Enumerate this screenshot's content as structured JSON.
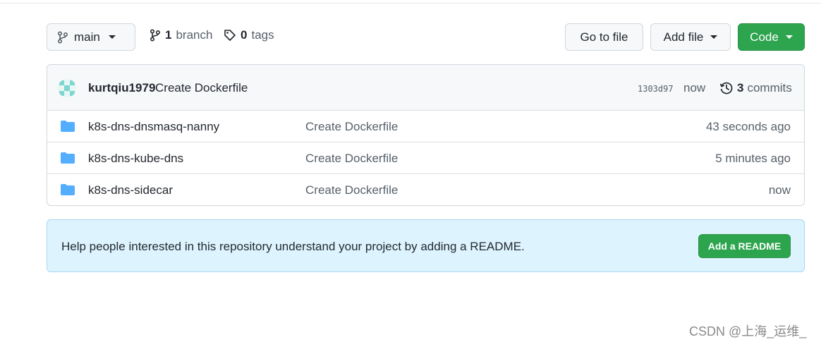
{
  "toolbar": {
    "branch_name": "main",
    "branch_count": "1",
    "branch_label": "branch",
    "tag_count": "0",
    "tag_label": "tags",
    "go_to_file": "Go to file",
    "add_file": "Add file",
    "code": "Code"
  },
  "latest_commit": {
    "author": "kurtqiu1979",
    "message": "Create Dockerfile",
    "sha": "1303d97",
    "time": "now",
    "commit_count": "3",
    "commit_label": "commits"
  },
  "files": [
    {
      "name": "k8s-dns-dnsmasq-nanny",
      "message": "Create Dockerfile",
      "time": "43 seconds ago",
      "icon": "folder-icon"
    },
    {
      "name": "k8s-dns-kube-dns",
      "message": "Create Dockerfile",
      "time": "5 minutes ago",
      "icon": "folder-icon"
    },
    {
      "name": "k8s-dns-sidecar",
      "message": "Create Dockerfile",
      "time": "now",
      "icon": "folder-icon"
    }
  ],
  "readme_banner": {
    "text": "Help people interested in this repository understand your project by adding a README.",
    "button": "Add a README"
  },
  "watermark": "CSDN @上海_运维_",
  "colors": {
    "accent_green": "#2da44e",
    "folder_blue": "#54aeff",
    "banner_bg": "#ddf4ff"
  }
}
